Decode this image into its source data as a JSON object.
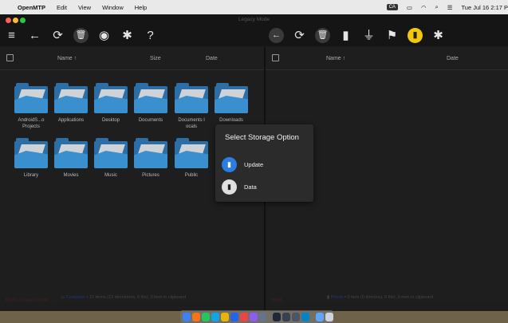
{
  "menubar": {
    "app_name": "OpenMTP",
    "menus": [
      "Edit",
      "View",
      "Window",
      "Help"
    ],
    "input_badge": "CA",
    "clock": "Tue Jul 16  2:17 P"
  },
  "window": {
    "title": "Legacy Mode",
    "left_toolbar_icons": [
      "menu-icon",
      "back-arrow-icon",
      "refresh-icon",
      "trash-icon",
      "github-icon",
      "settings-icon",
      "help-icon"
    ],
    "right_toolbar_icons": [
      "back-arrow-icon",
      "refresh-icon",
      "trash-icon",
      "sd-card-icon",
      "plug-icon",
      "flag-icon",
      "storage-icon",
      "settings-icon"
    ]
  },
  "left_pane": {
    "columns": {
      "name": "Name ↑",
      "size": "Size",
      "date": "Date"
    },
    "folders": [
      {
        "label": "AndroidS...o Projects"
      },
      {
        "label": "Applications"
      },
      {
        "label": "Desktop"
      },
      {
        "label": "Documents"
      },
      {
        "label": "Documents l ocals"
      },
      {
        "label": "Downloads"
      },
      {
        "label": "Library"
      },
      {
        "label": "Movies"
      },
      {
        "label": "Music"
      },
      {
        "label": "Pictures"
      },
      {
        "label": "Public"
      }
    ],
    "status_location": "Computer",
    "status_text": " • 12 items (12 directories, 0 file), 0 item in clipboard",
    "breadcrumb": [
      "Root",
      "Users",
      "infinit..."
    ]
  },
  "right_pane": {
    "columns": {
      "name": "Name ↑",
      "date": "Date"
    },
    "status_location": "Phone",
    "status_text": " • 0 item (0 directory, 0 file), 0 item in clipboard",
    "breadcrumb": [
      "Root"
    ]
  },
  "dialog": {
    "title": "Select Storage Option",
    "options": [
      {
        "label": "Update",
        "color": "#2a7de1"
      },
      {
        "label": "Data",
        "color": "#e0e0e0"
      }
    ]
  },
  "colors": {
    "accent": "#f2c80f",
    "folder": "#3a8fcf"
  }
}
